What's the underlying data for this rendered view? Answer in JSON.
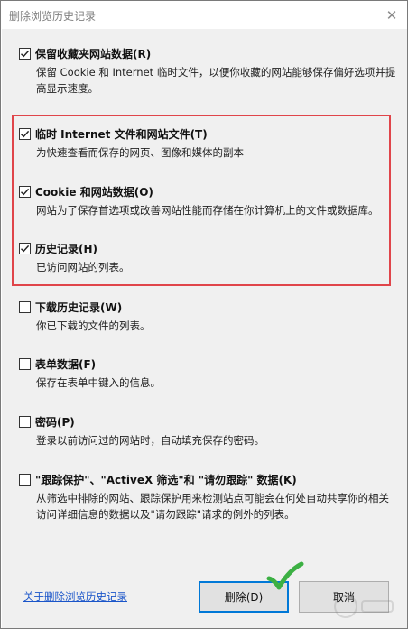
{
  "window": {
    "title": "删除浏览历史记录"
  },
  "options": [
    {
      "label": "保留收藏夹网站数据(R)",
      "checked": true,
      "desc": "保留 Cookie 和 Internet 临时文件，以便你收藏的网站能够保存偏好选项并提高显示速度。"
    },
    {
      "label": "临时 Internet 文件和网站文件(T)",
      "checked": true,
      "desc": "为快速查看而保存的网页、图像和媒体的副本"
    },
    {
      "label": "Cookie 和网站数据(O)",
      "checked": true,
      "desc": "网站为了保存首选项或改善网站性能而存储在你计算机上的文件或数据库。"
    },
    {
      "label": "历史记录(H)",
      "checked": true,
      "desc": "已访问网站的列表。"
    },
    {
      "label": "下载历史记录(W)",
      "checked": false,
      "desc": "你已下载的文件的列表。"
    },
    {
      "label": "表单数据(F)",
      "checked": false,
      "desc": "保存在表单中键入的信息。"
    },
    {
      "label": "密码(P)",
      "checked": false,
      "desc": "登录以前访问过的网站时，自动填充保存的密码。"
    },
    {
      "label": "\"跟踪保护\"、\"ActiveX 筛选\"和 \"请勿跟踪\" 数据(K)",
      "checked": false,
      "desc": "从筛选中排除的网站、跟踪保护用来检测站点可能会在何处自动共享你的相关访问详细信息的数据以及\"请勿跟踪\"请求的例外的列表。"
    }
  ],
  "footer": {
    "link": "关于删除浏览历史记录",
    "delete_button": "删除(D)",
    "cancel_button": "取消"
  },
  "colors": {
    "highlight": "#e0454a",
    "checkmark": "#3cb043",
    "link": "#1a55c9"
  },
  "icons": {
    "close": "close-icon",
    "annotation": "green-checkmark-icon"
  }
}
